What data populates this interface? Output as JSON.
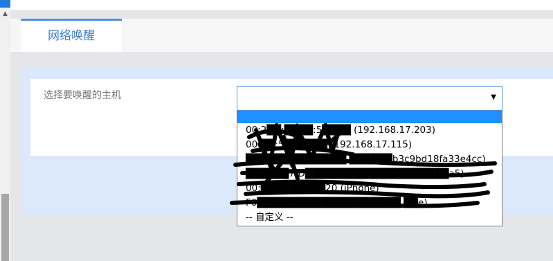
{
  "tab": {
    "label": "网络唤醒"
  },
  "form": {
    "label": "选择要唤醒的主机",
    "select_value": "",
    "options": [
      "",
      "00:2██:████:5████ (192.168.17.203)",
      "00:██:5██████ (192.168.17.115)",
      "██████████████ ██████b3c9bd18fa33e4cc)",
      "██████7:D████████████████████a5)",
      "00:█████████20 (iPhone)",
      "F0████████████████████ ██e)",
      "-- 自定义 --"
    ]
  },
  "icons": {
    "scroll_up": "triangle-up-icon",
    "select_arrow": "triangle-down-icon"
  },
  "colors": {
    "accent": "#4a90e2",
    "panel": "#dce8fb",
    "selected": "#1e90ff"
  }
}
